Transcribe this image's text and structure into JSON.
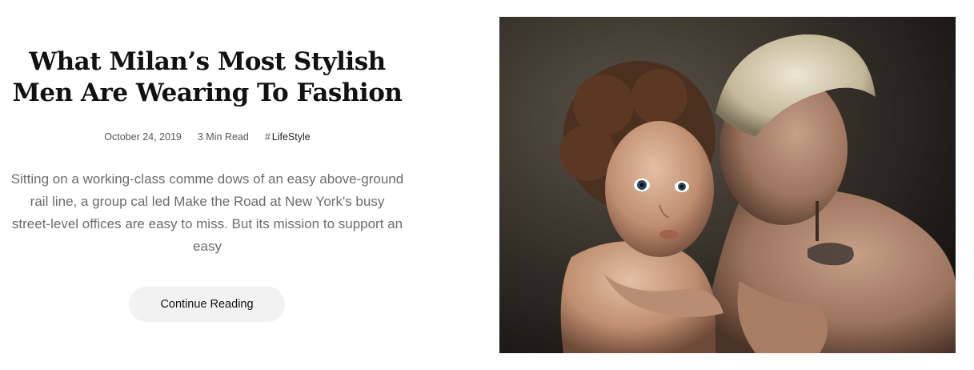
{
  "article": {
    "title": "What Milan’s Most Stylish Men Are Wearing To Fashion",
    "meta": {
      "date": "October 24, 2019",
      "read_time": "3 Min Read",
      "category_hash": "#",
      "category": "LifeStyle"
    },
    "excerpt": "Sitting on a working-class comme dows of an easy above-ground rail line, a group cal led Make the Road at New York's busy street-level offices are easy to miss. But its mission to support an easy",
    "cta_label": "Continue Reading"
  },
  "image": {
    "subject": "mother-and-child-portrait"
  },
  "colors": {
    "title": "#111111",
    "text": "#6c6c6c",
    "button_bg": "#f2f2f2",
    "photo_bg": "#2a2620"
  }
}
